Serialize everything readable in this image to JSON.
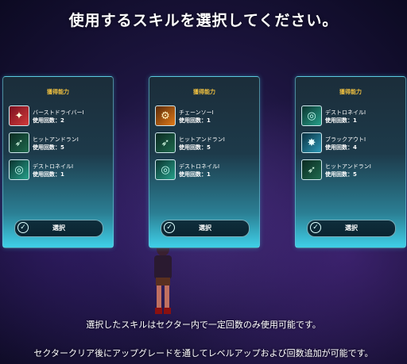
{
  "title": "使用するスキルを選択してください。",
  "cards": [
    {
      "header": "獲得能力",
      "skills": [
        {
          "icon": "burst-driver-icon",
          "name": "バーストドライバーI",
          "count": "使用回数：2"
        },
        {
          "icon": "hit-and-run-icon",
          "name": "ヒットアンドランI",
          "count": "使用回数：5"
        },
        {
          "icon": "destro-nail-icon",
          "name": "デストロネイルI",
          "count": "使用回数：1"
        }
      ],
      "button_label": "選択"
    },
    {
      "header": "獲得能力",
      "skills": [
        {
          "icon": "chainsaw-icon",
          "name": "チェーンソーI",
          "count": "使用回数：1"
        },
        {
          "icon": "hit-and-run-icon",
          "name": "ヒットアンドランI",
          "count": "使用回数：5"
        },
        {
          "icon": "destro-nail-icon",
          "name": "デストロネイルI",
          "count": "使用回数：1"
        }
      ],
      "button_label": "選択"
    },
    {
      "header": "獲得能力",
      "skills": [
        {
          "icon": "destro-nail-icon",
          "name": "デストロネイルI",
          "count": "使用回数：1"
        },
        {
          "icon": "blackout-icon",
          "name": "ブラックアウトI",
          "count": "使用回数：4"
        },
        {
          "icon": "hit-and-run-icon",
          "name": "ヒットアンドランI",
          "count": "使用回数：5"
        }
      ],
      "button_label": "選択"
    }
  ],
  "footer": {
    "line1": "選択したスキルはセクター内で一定回数のみ使用可能です。",
    "line2": "セクタークリア後にアップグレードを通してレベルアップおよび回数追加が可能です。"
  }
}
